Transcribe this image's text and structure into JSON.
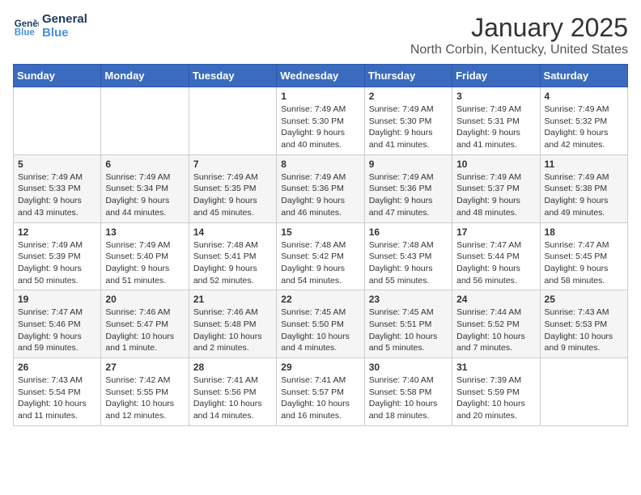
{
  "header": {
    "logo": {
      "line1": "General",
      "line2": "Blue"
    },
    "title": "January 2025",
    "location": "North Corbin, Kentucky, United States"
  },
  "weekdays": [
    "Sunday",
    "Monday",
    "Tuesday",
    "Wednesday",
    "Thursday",
    "Friday",
    "Saturday"
  ],
  "weeks": [
    [
      {
        "day": "",
        "info": ""
      },
      {
        "day": "",
        "info": ""
      },
      {
        "day": "",
        "info": ""
      },
      {
        "day": "1",
        "sunrise": "7:49 AM",
        "sunset": "5:30 PM",
        "daylight": "9 hours and 40 minutes."
      },
      {
        "day": "2",
        "sunrise": "7:49 AM",
        "sunset": "5:30 PM",
        "daylight": "9 hours and 41 minutes."
      },
      {
        "day": "3",
        "sunrise": "7:49 AM",
        "sunset": "5:31 PM",
        "daylight": "9 hours and 41 minutes."
      },
      {
        "day": "4",
        "sunrise": "7:49 AM",
        "sunset": "5:32 PM",
        "daylight": "9 hours and 42 minutes."
      }
    ],
    [
      {
        "day": "5",
        "sunrise": "7:49 AM",
        "sunset": "5:33 PM",
        "daylight": "9 hours and 43 minutes."
      },
      {
        "day": "6",
        "sunrise": "7:49 AM",
        "sunset": "5:34 PM",
        "daylight": "9 hours and 44 minutes."
      },
      {
        "day": "7",
        "sunrise": "7:49 AM",
        "sunset": "5:35 PM",
        "daylight": "9 hours and 45 minutes."
      },
      {
        "day": "8",
        "sunrise": "7:49 AM",
        "sunset": "5:36 PM",
        "daylight": "9 hours and 46 minutes."
      },
      {
        "day": "9",
        "sunrise": "7:49 AM",
        "sunset": "5:36 PM",
        "daylight": "9 hours and 47 minutes."
      },
      {
        "day": "10",
        "sunrise": "7:49 AM",
        "sunset": "5:37 PM",
        "daylight": "9 hours and 48 minutes."
      },
      {
        "day": "11",
        "sunrise": "7:49 AM",
        "sunset": "5:38 PM",
        "daylight": "9 hours and 49 minutes."
      }
    ],
    [
      {
        "day": "12",
        "sunrise": "7:49 AM",
        "sunset": "5:39 PM",
        "daylight": "9 hours and 50 minutes."
      },
      {
        "day": "13",
        "sunrise": "7:49 AM",
        "sunset": "5:40 PM",
        "daylight": "9 hours and 51 minutes."
      },
      {
        "day": "14",
        "sunrise": "7:48 AM",
        "sunset": "5:41 PM",
        "daylight": "9 hours and 52 minutes."
      },
      {
        "day": "15",
        "sunrise": "7:48 AM",
        "sunset": "5:42 PM",
        "daylight": "9 hours and 54 minutes."
      },
      {
        "day": "16",
        "sunrise": "7:48 AM",
        "sunset": "5:43 PM",
        "daylight": "9 hours and 55 minutes."
      },
      {
        "day": "17",
        "sunrise": "7:47 AM",
        "sunset": "5:44 PM",
        "daylight": "9 hours and 56 minutes."
      },
      {
        "day": "18",
        "sunrise": "7:47 AM",
        "sunset": "5:45 PM",
        "daylight": "9 hours and 58 minutes."
      }
    ],
    [
      {
        "day": "19",
        "sunrise": "7:47 AM",
        "sunset": "5:46 PM",
        "daylight": "9 hours and 59 minutes."
      },
      {
        "day": "20",
        "sunrise": "7:46 AM",
        "sunset": "5:47 PM",
        "daylight": "10 hours and 1 minute."
      },
      {
        "day": "21",
        "sunrise": "7:46 AM",
        "sunset": "5:48 PM",
        "daylight": "10 hours and 2 minutes."
      },
      {
        "day": "22",
        "sunrise": "7:45 AM",
        "sunset": "5:50 PM",
        "daylight": "10 hours and 4 minutes."
      },
      {
        "day": "23",
        "sunrise": "7:45 AM",
        "sunset": "5:51 PM",
        "daylight": "10 hours and 5 minutes."
      },
      {
        "day": "24",
        "sunrise": "7:44 AM",
        "sunset": "5:52 PM",
        "daylight": "10 hours and 7 minutes."
      },
      {
        "day": "25",
        "sunrise": "7:43 AM",
        "sunset": "5:53 PM",
        "daylight": "10 hours and 9 minutes."
      }
    ],
    [
      {
        "day": "26",
        "sunrise": "7:43 AM",
        "sunset": "5:54 PM",
        "daylight": "10 hours and 11 minutes."
      },
      {
        "day": "27",
        "sunrise": "7:42 AM",
        "sunset": "5:55 PM",
        "daylight": "10 hours and 12 minutes."
      },
      {
        "day": "28",
        "sunrise": "7:41 AM",
        "sunset": "5:56 PM",
        "daylight": "10 hours and 14 minutes."
      },
      {
        "day": "29",
        "sunrise": "7:41 AM",
        "sunset": "5:57 PM",
        "daylight": "10 hours and 16 minutes."
      },
      {
        "day": "30",
        "sunrise": "7:40 AM",
        "sunset": "5:58 PM",
        "daylight": "10 hours and 18 minutes."
      },
      {
        "day": "31",
        "sunrise": "7:39 AM",
        "sunset": "5:59 PM",
        "daylight": "10 hours and 20 minutes."
      },
      {
        "day": "",
        "info": ""
      }
    ]
  ],
  "labels": {
    "sunrise_prefix": "Sunrise: ",
    "sunset_prefix": "Sunset: ",
    "daylight_prefix": "Daylight: "
  }
}
